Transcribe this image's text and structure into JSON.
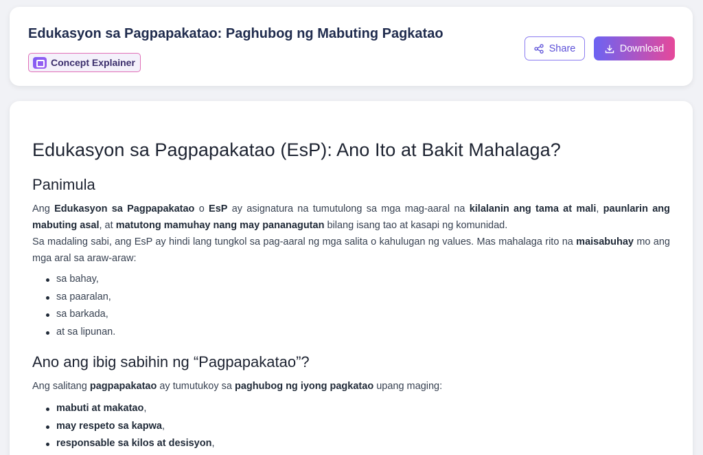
{
  "header": {
    "title": "Edukasyon sa Pagpapakatao: Paghubog ng Mabuting Pagkatao",
    "badge_label": "Concept Explainer",
    "badge_icon": "presentation-icon",
    "share_label": "Share",
    "share_icon": "share-icon",
    "download_label": "Download",
    "download_icon": "download-icon"
  },
  "colors": {
    "accent_start": "#6c63f2",
    "accent_end": "#e6499a",
    "share_border": "#8b7cf0",
    "title_color": "#1f2b4d"
  },
  "article": {
    "title": "Edukasyon sa Pagpapakatao (EsP): Ano Ito at Bakit Mahalaga?",
    "intro_heading": "Panimula",
    "p1": [
      {
        "t": "Ang ",
        "b": false
      },
      {
        "t": "Edukasyon sa Pagpapakatao",
        "b": true
      },
      {
        "t": " o ",
        "b": false
      },
      {
        "t": "EsP",
        "b": true
      },
      {
        "t": " ay asignatura na tumutulong sa mga mag-aaral na ",
        "b": false
      },
      {
        "t": "kilalanin ang tama at mali",
        "b": true
      },
      {
        "t": ", ",
        "b": false
      },
      {
        "t": "paunlarin ang mabuting asal",
        "b": true
      },
      {
        "t": ", at ",
        "b": false
      },
      {
        "t": "matutong mamuhay nang may pananagutan",
        "b": true
      },
      {
        "t": " bilang isang tao at kasapi ng komunidad.",
        "b": false
      }
    ],
    "p2": [
      {
        "t": "Sa madaling sabi, ang EsP ay hindi lang tungkol sa pag-aaral ng mga salita o kahulugan ng values. Mas mahalaga rito na ",
        "b": false
      },
      {
        "t": "maisabuhay",
        "b": true
      },
      {
        "t": " mo ang mga aral sa araw-araw:",
        "b": false
      }
    ],
    "places": [
      "sa bahay,",
      "sa paaralan,",
      "sa barkada,",
      "at sa lipunan."
    ],
    "meaning_heading": "Ano ang ibig sabihin ng “Pagpapakatao”?",
    "p3": [
      {
        "t": "Ang salitang ",
        "b": false
      },
      {
        "t": "pagpapakatao",
        "b": true
      },
      {
        "t": " ay tumutukoy sa ",
        "b": false
      },
      {
        "t": "paghubog ng iyong pagkatao",
        "b": true
      },
      {
        "t": " upang maging:",
        "b": false
      }
    ],
    "traits": [
      [
        {
          "t": "mabuti at makatao",
          "b": true
        },
        {
          "t": ",",
          "b": false
        }
      ],
      [
        {
          "t": "may respeto sa kapwa",
          "b": true
        },
        {
          "t": ",",
          "b": false
        }
      ],
      [
        {
          "t": "responsable sa kilos at desisyon",
          "b": true
        },
        {
          "t": ",",
          "b": false
        }
      ]
    ]
  }
}
